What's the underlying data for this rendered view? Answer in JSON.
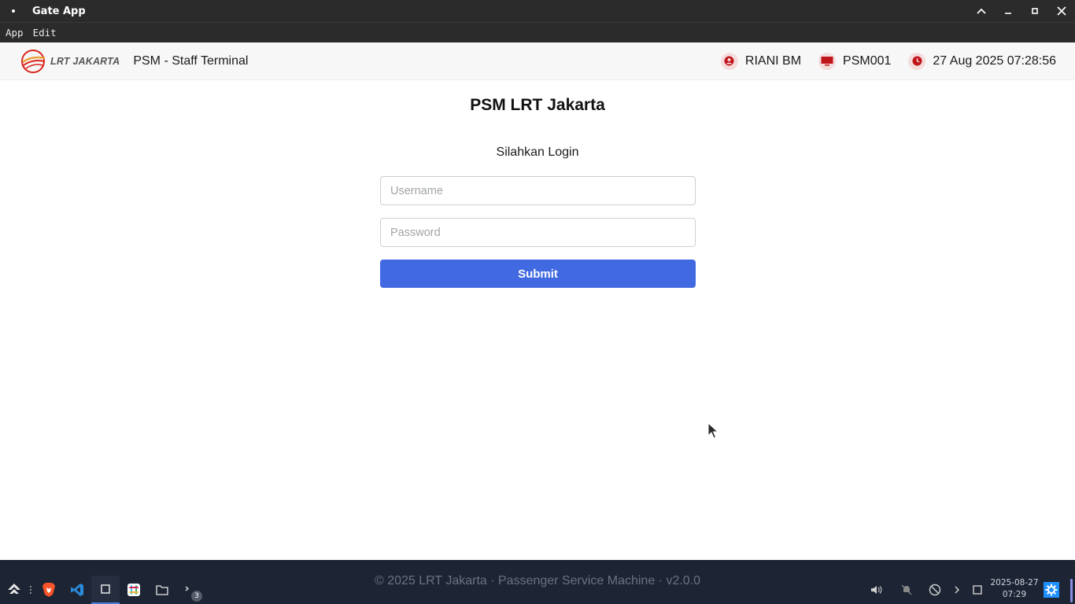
{
  "window": {
    "title": "Gate App"
  },
  "menubar": {
    "items": [
      "App",
      "Edit"
    ]
  },
  "header": {
    "logo_text": "LRT JAKARTA",
    "title": "PSM - Staff Terminal",
    "user": "RIANI BM",
    "terminal": "PSM001",
    "datetime": "27 Aug 2025 07:28:56",
    "icon_color": "#c0141b"
  },
  "login": {
    "page_title": "PSM LRT Jakarta",
    "subtitle": "Silahkan Login",
    "username_placeholder": "Username",
    "password_placeholder": "Password",
    "submit_label": "Submit",
    "submit_color": "#4169e1"
  },
  "footer": {
    "text": "© 2025 LRT Jakarta · Passenger Service Machine · v2.0.0"
  },
  "taskbar": {
    "apps": [
      "launcher-icon",
      "brave-browser-icon",
      "vscode-icon",
      "window-icon",
      "slack-icon",
      "file-manager-icon",
      "terminal-icon"
    ],
    "terminal_badge": "3",
    "clock_date": "2025-08-27",
    "clock_time": "07:29"
  }
}
